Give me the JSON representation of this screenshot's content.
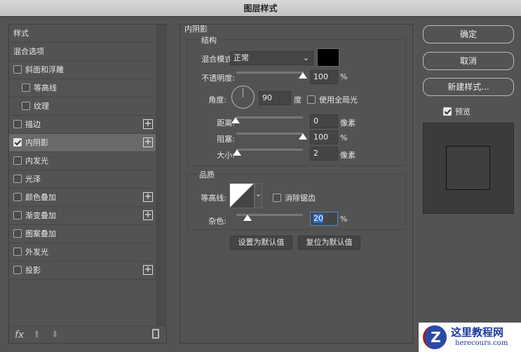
{
  "title": "图层样式",
  "left": {
    "items": [
      {
        "label": "样式",
        "checkbox": false
      },
      {
        "label": "混合选项",
        "checkbox": false
      },
      {
        "label": "斜面和浮雕",
        "checkbox": true,
        "checked": false
      },
      {
        "label": "等高线",
        "checkbox": true,
        "checked": false
      },
      {
        "label": "纹理",
        "checkbox": true,
        "checked": false
      },
      {
        "label": "描边",
        "checkbox": true,
        "checked": false,
        "plus": true
      },
      {
        "label": "内阴影",
        "checkbox": true,
        "checked": true,
        "plus": true,
        "selected": true
      },
      {
        "label": "内发光",
        "checkbox": true,
        "checked": false
      },
      {
        "label": "光泽",
        "checkbox": true,
        "checked": false
      },
      {
        "label": "颜色叠加",
        "checkbox": true,
        "checked": false,
        "plus": true
      },
      {
        "label": "渐变叠加",
        "checkbox": true,
        "checked": false,
        "plus": true
      },
      {
        "label": "图案叠加",
        "checkbox": true,
        "checked": false
      },
      {
        "label": "外发光",
        "checkbox": true,
        "checked": false
      },
      {
        "label": "投影",
        "checkbox": true,
        "checked": false,
        "plus": true
      }
    ],
    "fx_label": "fx"
  },
  "panel": {
    "title": "内阴影",
    "structure": "结构",
    "blend_mode_label": "混合模式:",
    "blend_mode": "正常",
    "shadow_color": "#000000",
    "opacity_label": "不透明度:",
    "opacity": "100",
    "opacity_value": 100,
    "pct": "%",
    "angle_label": "角度:",
    "angle": "90",
    "degree": "度",
    "global_light": "使用全局光",
    "distance_label": "距离:",
    "distance": "0",
    "px": "像素",
    "choke_label": "阻塞:",
    "choke": "100",
    "size_label": "大小:",
    "size": "2",
    "quality": "品质",
    "contour_label": "等高线:",
    "antialias": "消除锯齿",
    "noise_label": "杂色:",
    "noise": "20",
    "set_default": "设置为默认值",
    "reset_default": "复位为默认值"
  },
  "right": {
    "ok": "确定",
    "cancel": "取消",
    "new_style": "新建样式...",
    "preview": "预览"
  },
  "watermark": {
    "name": "这里教程网",
    "url": "herecours.com"
  }
}
